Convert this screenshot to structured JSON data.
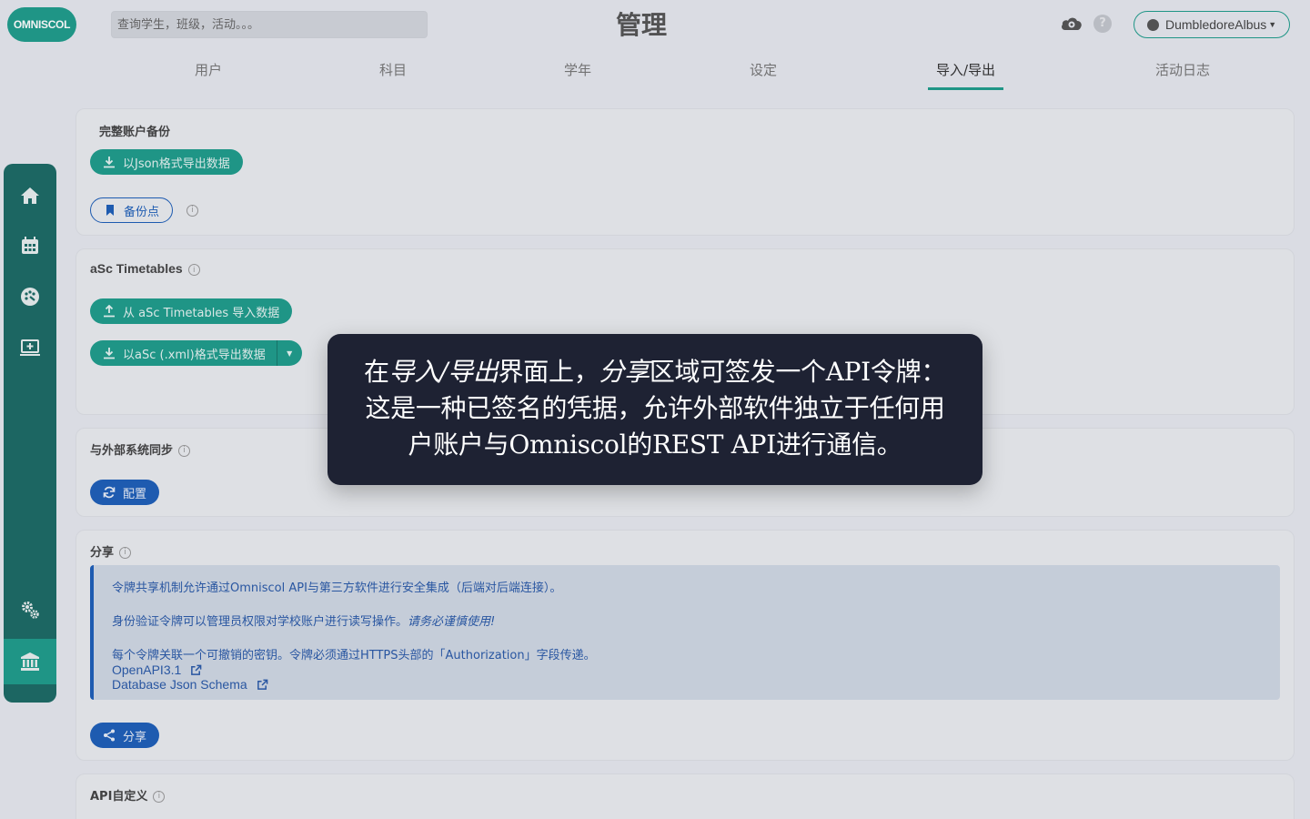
{
  "app": {
    "logo_text": "OMNISCOL",
    "page_title": "管理",
    "search_placeholder": "查询学生，班级，活动。。。",
    "user_name": "DumbledoreAlbus",
    "help_glyph": "?",
    "accent_color": "#1f9d8c",
    "primary_color": "#1e5fb8"
  },
  "tabs": [
    {
      "label": "用户"
    },
    {
      "label": "科目"
    },
    {
      "label": "学年"
    },
    {
      "label": "设定"
    },
    {
      "label": "导入/导出",
      "active": true
    },
    {
      "label": "活动日志"
    }
  ],
  "sidebar": {
    "items": [
      {
        "icon": "home-icon"
      },
      {
        "icon": "calendar-icon"
      },
      {
        "icon": "palette-icon"
      },
      {
        "icon": "monitor-plus-icon"
      },
      {
        "icon": "gears-icon"
      },
      {
        "icon": "institution-icon",
        "active": true
      }
    ]
  },
  "backup": {
    "title": "完整账户备份",
    "export_json_label": "以Json格式导出数据",
    "checkpoint_label": "备份点",
    "info_glyph": "i"
  },
  "asc": {
    "title": "aSc Timetables",
    "import_label": "从 aSc Timetables 导入数据",
    "export_label": "以aSc (.xml)格式导出数据"
  },
  "sync": {
    "title": "与外部系统同步",
    "config_label": "配置"
  },
  "share": {
    "title": "分享",
    "line1": "令牌共享机制允许通过Omniscol API与第三方软件进行安全集成（后端对后端连接）。",
    "line2_prefix": "身份验证令牌可以管理员权限对学校账户进行读写操作。",
    "line2_emphasis": "请务必谨慎使用!",
    "line3": "每个令牌关联一个可撤销的密钥。令牌必须通过HTTPS头部的「Authorization」字段传递。",
    "link_openapi": "OpenAPI3.1",
    "link_schema": "Database Json Schema",
    "share_label": "分享"
  },
  "api_custom": {
    "title": "API自定义"
  },
  "tooltip": {
    "part1": "在",
    "part2_italic": "导入/导出",
    "part3": "界面上，",
    "part4_italic": "分享",
    "part5": "区域可签发一个API令牌：这是一种已签名的凭据，允许外部软件独立于任何用户账户与Omniscol的REST API进行通信。"
  }
}
